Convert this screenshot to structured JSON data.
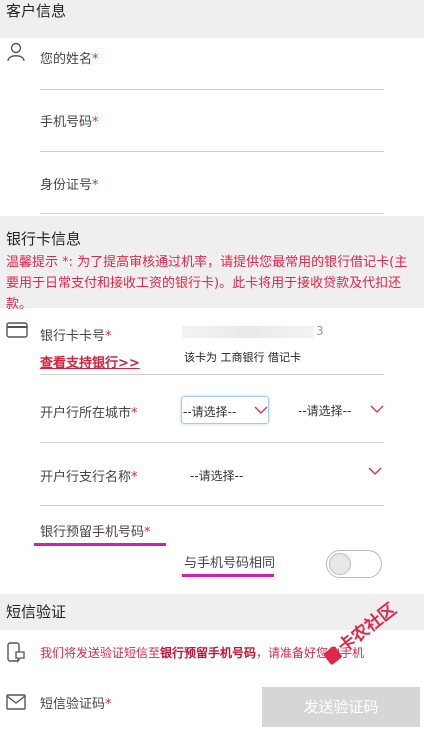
{
  "customer": {
    "title": "客户信息",
    "name_label": "您的姓名",
    "phone_label": "手机号码",
    "id_label": "身份证号",
    "required_mark": "*"
  },
  "bank": {
    "title": "银行卡信息",
    "notice": "温馨提示 *: 为了提高审核通过机率，请提供您最常用的银行借记卡(主要用于日常支付和接收工资的银行卡)。此卡将用于接收贷款及代扣还款。",
    "card_label": "银行卡卡号",
    "card_value_tail": "3",
    "support_link": "查看支持银行>>",
    "card_type": "该卡为 工商银行 借记卡",
    "city_label": "开户行所在城市",
    "city_select_1": "--请选择--",
    "city_select_2": "--请选择--",
    "branch_label": "开户行支行名称",
    "branch_select": "--请选择--",
    "reserved_phone_label": "银行预留手机号码",
    "same_as_phone": "与手机号码相同"
  },
  "sms": {
    "title": "短信验证",
    "info_prefix": "我们将发送验证短信至",
    "info_bold": "银行预留手机号码",
    "info_suffix": "，请准备好您的手机",
    "code_label": "短信验证码",
    "send_button": "发送验证码"
  },
  "watermark": "卡农社区",
  "colors": {
    "accent": "#e0264a",
    "section_bg": "#efefef",
    "highlight": "#d11fb6"
  }
}
